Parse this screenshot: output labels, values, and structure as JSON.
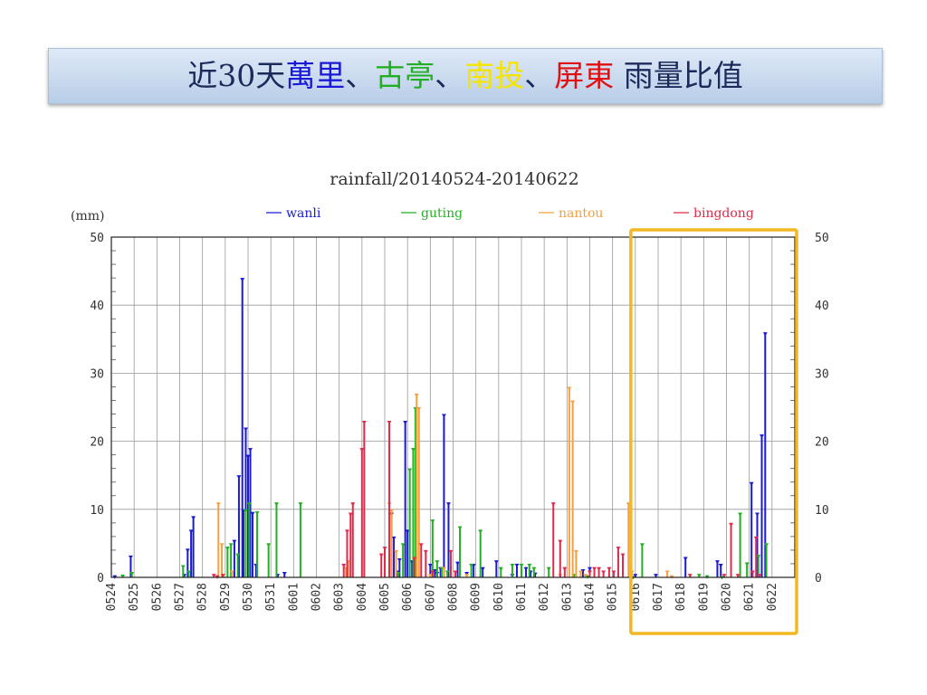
{
  "slide": {
    "title_parts": [
      {
        "text": "近30天",
        "color": "#1a2a5a"
      },
      {
        "text": "萬里",
        "color": "#1a1ad6"
      },
      {
        "text": "、",
        "color": "#1a2a5a"
      },
      {
        "text": "古亭",
        "color": "#22b022"
      },
      {
        "text": "、",
        "color": "#1a2a5a"
      },
      {
        "text": "南投",
        "color": "#f5e400"
      },
      {
        "text": "、",
        "color": "#1a2a5a"
      },
      {
        "text": "屏東",
        "color": "#e01010"
      },
      {
        "text": " 雨量比值",
        "color": "#1a2a5a"
      }
    ]
  },
  "chart_data": {
    "type": "bar",
    "title": "rainfall/20140524-20140622",
    "ylabel": "(mm)",
    "ylim": [
      0,
      50
    ],
    "yticks": [
      0,
      10,
      20,
      30,
      40,
      50
    ],
    "grid": true,
    "legend_position": "top",
    "categories": [
      "0524",
      "0525",
      "0526",
      "0527",
      "0528",
      "0529",
      "0530",
      "0531",
      "0601",
      "0602",
      "0603",
      "0604",
      "0605",
      "0606",
      "0607",
      "0608",
      "0609",
      "0610",
      "0611",
      "0612",
      "0613",
      "0614",
      "0615",
      "0616",
      "0617",
      "0618",
      "0619",
      "0620",
      "0621",
      "0622"
    ],
    "highlight_range": [
      "0616",
      "0622"
    ],
    "highlight_color": "#f2b824",
    "series": [
      {
        "name": "wanli",
        "color": "#1a1ad6",
        "x": [
          0.15,
          0.85,
          3.2,
          3.35,
          3.5,
          3.6,
          5.4,
          5.6,
          5.75,
          5.8,
          5.9,
          6.0,
          6.1,
          6.2,
          6.35,
          7.3,
          7.6,
          12.3,
          12.4,
          12.55,
          12.65,
          12.9,
          13.0,
          13.2,
          14.0,
          14.2,
          14.3,
          14.45,
          14.6,
          14.8,
          15.2,
          15.6,
          15.9,
          16.3,
          16.9,
          17.6,
          17.8,
          18.2,
          18.4,
          18.6,
          20.7,
          21.0,
          23.0,
          23.9,
          25.2,
          26.6,
          26.75,
          28.1,
          28.35,
          28.55,
          28.7
        ],
        "values": [
          0.3,
          3.2,
          0.5,
          4.2,
          7,
          9,
          5.5,
          15,
          44,
          10,
          22,
          18,
          19,
          9.6,
          2,
          0.5,
          0.8,
          9.5,
          6,
          1,
          2.8,
          23,
          7,
          2.5,
          2,
          1.2,
          0.8,
          1.5,
          24,
          11,
          2.3,
          0.8,
          2,
          1.5,
          2.5,
          0.5,
          2,
          1.5,
          1,
          0.7,
          1.2,
          1.5,
          0.5,
          0.5,
          3,
          2.5,
          2,
          14,
          9.5,
          21,
          36
        ]
      },
      {
        "name": "guting",
        "color": "#22b022",
        "x": [
          0.5,
          0.9,
          3.15,
          3.4,
          5.1,
          5.25,
          5.55,
          5.9,
          6.05,
          6.4,
          6.9,
          7.25,
          8.3,
          12.6,
          12.8,
          13.1,
          13.25,
          13.35,
          14.1,
          14.3,
          14.5,
          14.75,
          15.3,
          15.8,
          16.2,
          17.1,
          17.6,
          18.0,
          18.35,
          18.55,
          19.2,
          20.3,
          20.9,
          22.9,
          23.3,
          25.8,
          26.15,
          26.8,
          27.6,
          27.9,
          28.4,
          28.75
        ],
        "values": [
          0.4,
          0.8,
          1.8,
          1,
          4.5,
          5,
          3.5,
          10,
          11,
          9.7,
          5,
          11,
          11,
          0.8,
          5,
          16,
          19,
          25,
          8.5,
          2.5,
          1.5,
          1,
          7.5,
          2,
          7,
          1.5,
          2,
          2,
          2,
          1.5,
          1.5,
          0.5,
          0.3,
          0.2,
          5,
          0.5,
          0.3,
          0.2,
          9.5,
          2.2,
          3.3,
          5
        ]
      },
      {
        "name": "nantou",
        "color": "#f5a040",
        "x": [
          4.7,
          4.85,
          5.3,
          10.3,
          10.4,
          12.2,
          12.3,
          12.5,
          13.4,
          13.5,
          14.0,
          14.6,
          15.6,
          19.7,
          20.1,
          20.25,
          20.4,
          20.6,
          20.8,
          22.7,
          22.85,
          24.4,
          24.6
        ],
        "values": [
          11,
          5,
          1,
          1.5,
          2.5,
          11,
          10,
          4,
          27,
          25,
          0.5,
          1.5,
          0.5,
          0.5,
          28,
          26,
          4,
          1,
          0.5,
          11,
          1,
          1,
          0.3
        ]
      },
      {
        "name": "bingdong",
        "color": "#e02a4a",
        "x": [
          4.5,
          4.65,
          4.9,
          10.2,
          10.35,
          10.5,
          10.6,
          11.0,
          11.1,
          11.85,
          12.0,
          12.2,
          13.3,
          13.6,
          13.8,
          14.1,
          14.9,
          15.1,
          19.4,
          19.7,
          19.9,
          21.0,
          21.2,
          21.4,
          21.6,
          21.85,
          22.05,
          22.25,
          22.45,
          25.4,
          26.9,
          27.2,
          27.5,
          28.15,
          28.3,
          28.45
        ],
        "values": [
          0.5,
          0.3,
          0.5,
          2,
          7,
          9.5,
          11,
          19,
          23,
          3.5,
          4.5,
          23,
          3,
          5,
          4,
          1,
          4,
          1,
          11,
          5.5,
          1.5,
          1,
          1.5,
          1.5,
          1,
          1.5,
          1,
          4.5,
          3.5,
          0.5,
          0.5,
          8,
          0.5,
          1,
          6,
          0.5
        ]
      }
    ]
  }
}
